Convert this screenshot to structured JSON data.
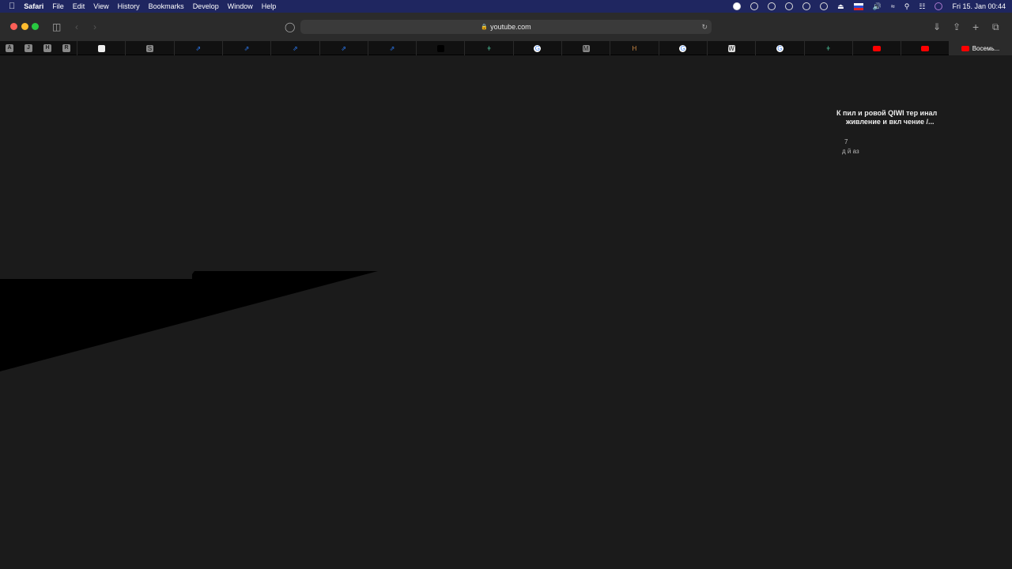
{
  "menubar": {
    "apple": "",
    "app": "Safari",
    "items": [
      "File",
      "Edit",
      "View",
      "History",
      "Bookmarks",
      "Develop",
      "Window",
      "Help"
    ],
    "clock": "Fri 15. Jan  00:44"
  },
  "toolbar": {
    "url": "youtube.com"
  },
  "pinned_tabs": [
    "A",
    "J",
    "H",
    "R"
  ],
  "tabs": [
    "apple",
    "S",
    "jira",
    "jira",
    "jira",
    "jira",
    "jira",
    "black",
    "plant",
    "google",
    "M",
    "H",
    "google",
    "W",
    "google",
    "plant",
    "youtube",
    "youtube"
  ],
  "active_tab": {
    "title": "Восемь..."
  },
  "video": {
    "title_line1": "К пил и ровой QIWI тер инал",
    "title_line2": "живление и вкл чение /...",
    "meta1": "7",
    "meta2": "д й аз"
  },
  "colors": {
    "menubar": "#1f2660",
    "bg": "#1b1b1b"
  }
}
